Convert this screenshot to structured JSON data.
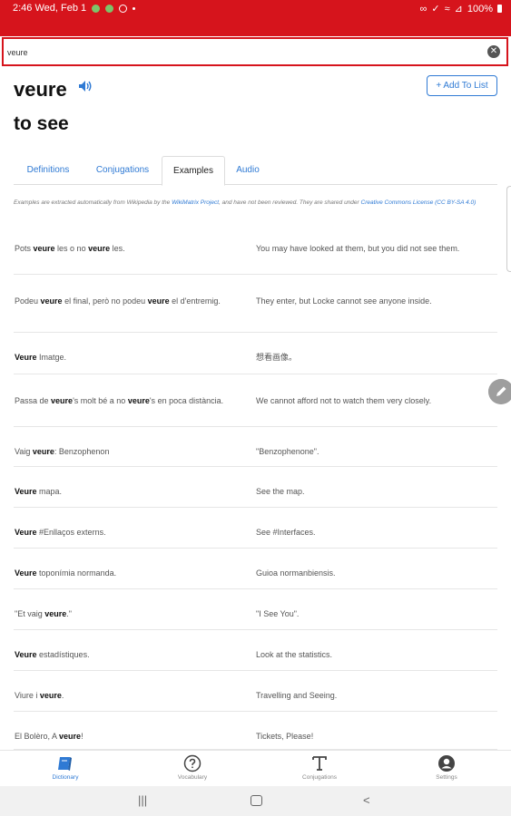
{
  "status_bar": {
    "time_date": "2:46 Wed, Feb 1",
    "battery": "100%"
  },
  "search": {
    "value": "veure",
    "clear_icon": "close-circle-icon"
  },
  "entry": {
    "word": "veure",
    "translation": "to see",
    "add_button": "+ Add To List"
  },
  "tabs": [
    {
      "label": "Definitions",
      "active": false
    },
    {
      "label": "Conjugations",
      "active": false
    },
    {
      "label": "Examples",
      "active": true
    },
    {
      "label": "Audio",
      "active": false
    }
  ],
  "notice": {
    "prefix": "Examples are extracted automatically from Wikipedia by the ",
    "link1": "WikiMatrix Project",
    "middle": ", and have not been reviewed. They are shared under ",
    "link2": "Creative Commons License (CC BY-SA 4.0)"
  },
  "examples": [
    {
      "src_html": "Pots <b>veure</b> les o no <b>veure</b> les.",
      "dst": "You may have looked at them, but you did not see them."
    },
    {
      "src_html": "Podeu <b>veure</b> el final, però no podeu <b>veure</b> el d'entremig.",
      "dst": "They enter, but Locke cannot see anyone inside."
    },
    {
      "src_html": "<b>Veure</b> Imatge.",
      "dst": "想看画像。"
    },
    {
      "src_html": "Passa de <b>veure</b>'s molt bé a no <b>veure</b>'s en poca distància.",
      "dst": "We cannot afford not to watch them very closely."
    },
    {
      "src_html": "Vaig <b>veure</b>: Benzophenon",
      "dst": "\"Benzophenone\"."
    },
    {
      "src_html": "<b>Veure</b> mapa.",
      "dst": "See the map."
    },
    {
      "src_html": "<b>Veure</b> #Enllaços externs.",
      "dst": "See #Interfaces."
    },
    {
      "src_html": "<b>Veure</b> toponímia normanda.",
      "dst": "Guioa normanbiensis."
    },
    {
      "src_html": "\"Et vaig <b>veure</b>.\"",
      "dst": "\"I See You\"."
    },
    {
      "src_html": "<b>Veure</b> estadístiques.",
      "dst": "Look at the statistics."
    },
    {
      "src_html": "Viure i <b>veure</b>.",
      "dst": "Travelling and Seeing."
    },
    {
      "src_html": "El Bolèro, A <b>veure</b>!",
      "dst": "Tickets, Please!"
    }
  ],
  "bottom_nav": [
    {
      "label": "Dictionary",
      "icon": "book-icon",
      "active": true
    },
    {
      "label": "Vocabulary",
      "icon": "question-circle-icon",
      "active": false
    },
    {
      "label": "Conjugations",
      "icon": "text-t-icon",
      "active": false
    },
    {
      "label": "Settings",
      "icon": "user-circle-icon",
      "active": false
    }
  ],
  "colors": {
    "brand_red": "#d6141c",
    "link_blue": "#2f7ad4"
  }
}
